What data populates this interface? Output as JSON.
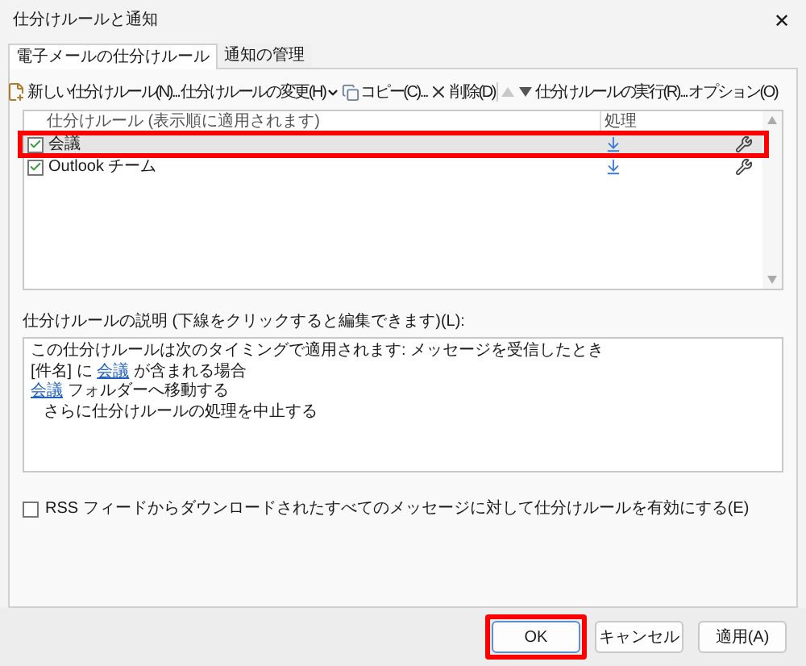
{
  "window": {
    "title": "仕分けルールと通知",
    "close": "✕"
  },
  "tabs": [
    {
      "label": "電子メールの仕分けルール",
      "selected": true
    },
    {
      "label": "通知の管理",
      "selected": false
    }
  ],
  "toolbar": [
    {
      "kind": "new-button",
      "label": "新しい仕分けルール(N)..."
    },
    {
      "kind": "menu",
      "label": "仕分けルールの変更(H)"
    },
    {
      "kind": "copy-button",
      "label": "コピー(C)..."
    },
    {
      "kind": "delete-button",
      "label": "削除(D)"
    },
    {
      "kind": "up",
      "disabled": true
    },
    {
      "kind": "down",
      "disabled": false
    },
    {
      "kind": "button",
      "label": "仕分けルールの実行(R)..."
    },
    {
      "kind": "button",
      "label": "オプション(O)"
    }
  ],
  "rules_table": {
    "columns": [
      "仕分けルール (表示順に適用されます)",
      "処理"
    ],
    "rows": [
      {
        "name": "会議",
        "checked": true,
        "selected": true,
        "highlighted": true
      },
      {
        "name": "Outlook チーム",
        "checked": true,
        "selected": false,
        "highlighted": false
      }
    ]
  },
  "description": {
    "label": "仕分けルールの説明 (下線をクリックすると編集できます)(L):",
    "lines": [
      {
        "indent": false,
        "segments": [
          {
            "kind": "text",
            "text": "この仕分けルールは次のタイミングで適用されます: メッセージを受信したとき"
          }
        ]
      },
      {
        "indent": false,
        "segments": [
          {
            "kind": "text",
            "text": "[件名] に "
          },
          {
            "kind": "link",
            "text": "会議"
          },
          {
            "kind": "text",
            "text": " が含まれる場合"
          }
        ]
      },
      {
        "indent": false,
        "segments": [
          {
            "kind": "link",
            "text": "会議"
          },
          {
            "kind": "text",
            "text": " フォルダーへ移動する"
          }
        ]
      },
      {
        "indent": true,
        "segments": [
          {
            "kind": "text",
            "text": "さらに仕分けルールの処理を中止する"
          }
        ]
      }
    ]
  },
  "rss_option": {
    "label": "RSS フィードからダウンロードされたすべてのメッセージに対して仕分けルールを有効にする(E)",
    "checked": false
  },
  "buttons": [
    {
      "label": "OK",
      "highlighted": true
    },
    {
      "label": "キャンセル",
      "highlighted": false
    },
    {
      "label": "適用(A)",
      "highlighted": false
    }
  ]
}
